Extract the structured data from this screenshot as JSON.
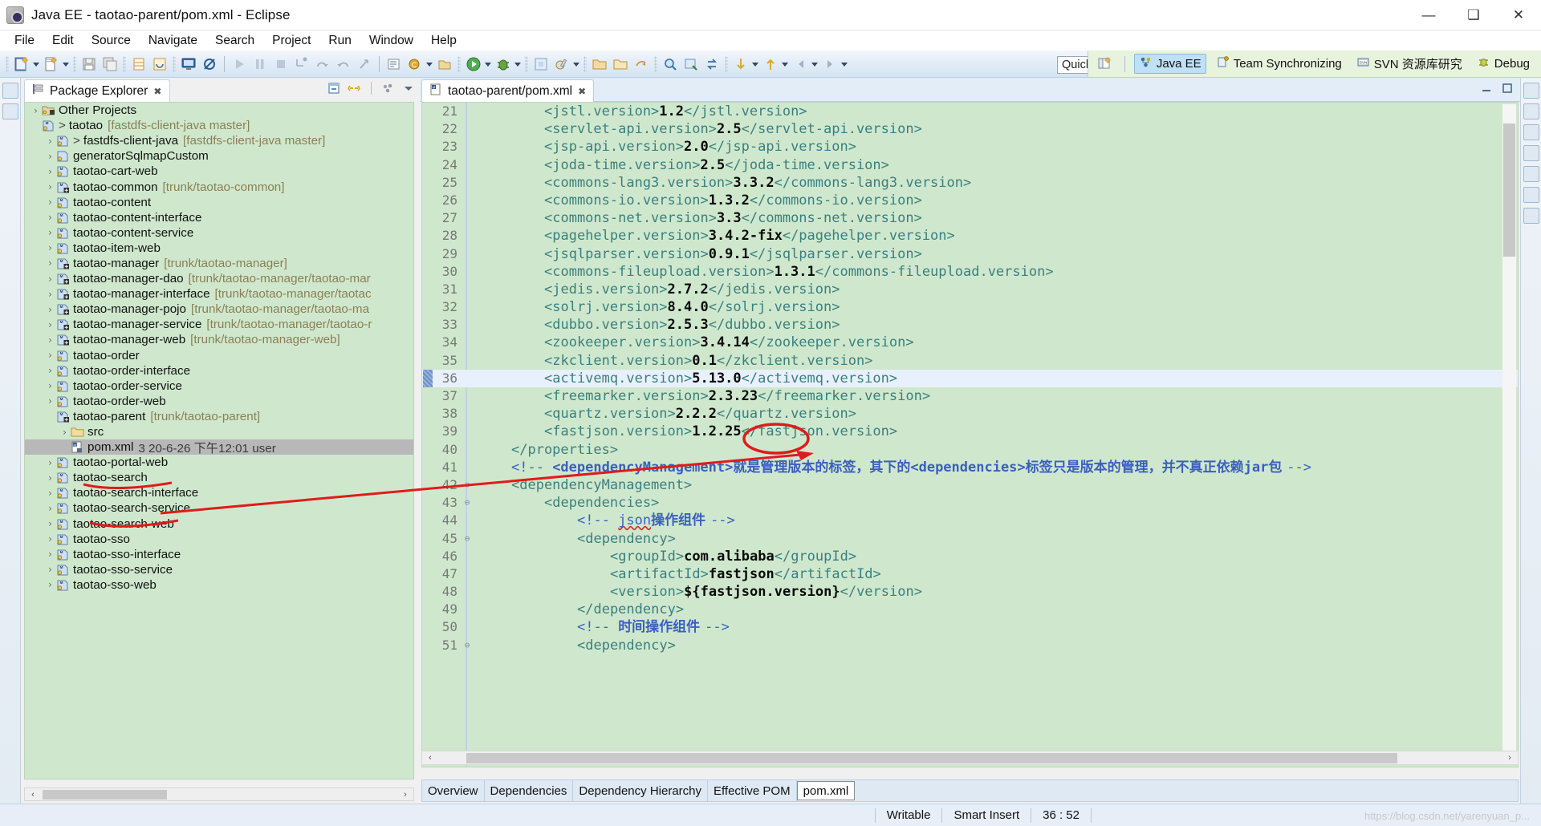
{
  "window": {
    "title": "Java EE - taotao-parent/pom.xml - Eclipse",
    "app_icon": "eclipse-icon",
    "minimize": "—",
    "maximize": "❑",
    "close": "✕"
  },
  "menu": {
    "items": [
      "File",
      "Edit",
      "Source",
      "Navigate",
      "Search",
      "Project",
      "Run",
      "Window",
      "Help"
    ]
  },
  "toolbar": {
    "quick_access_placeholder": "Quick Access",
    "quick_access_value": "Quick Access"
  },
  "perspectives": {
    "items": [
      {
        "label": "Java EE",
        "icon": "java-ee-perspective-icon",
        "active": true
      },
      {
        "label": "Team Synchronizing",
        "icon": "team-sync-icon",
        "active": false
      },
      {
        "label": "SVN 资源库研究",
        "icon": "svn-icon",
        "active": false
      },
      {
        "label": "Debug",
        "icon": "debug-icon",
        "active": false
      }
    ],
    "open_perspective_icon": "open-perspective-icon"
  },
  "package_explorer": {
    "tab_label": "Package Explorer",
    "tab_icon": "package-explorer-icon",
    "close_icon": "✖",
    "tools": [
      "collapse-all-icon",
      "link-with-editor-icon",
      "view-menu-icon",
      "minimize-icon"
    ],
    "tree": [
      {
        "indent": 0,
        "arrow": "›",
        "icon": "other-projects-icon",
        "label": "Other Projects",
        "location": "",
        "prefix": ""
      },
      {
        "indent": 0,
        "arrow": "ⱟ",
        "icon": "maven-project-icon",
        "label": "taotao",
        "location": "[fastdfs-client-java master]",
        "prefix": ">"
      },
      {
        "indent": 1,
        "arrow": "›",
        "icon": "maven-project-icon",
        "label": "fastdfs-client-java",
        "location": "[fastdfs-client-java master]",
        "prefix": ">"
      },
      {
        "indent": 1,
        "arrow": "›",
        "icon": "java-project-icon",
        "label": "generatorSqlmapCustom",
        "location": "",
        "prefix": ""
      },
      {
        "indent": 1,
        "arrow": "›",
        "icon": "maven-project-icon",
        "label": "taotao-cart-web",
        "location": "",
        "prefix": ""
      },
      {
        "indent": 1,
        "arrow": "›",
        "icon": "maven-svn-project-icon",
        "label": "taotao-common",
        "location": "[trunk/taotao-common]",
        "prefix": ""
      },
      {
        "indent": 1,
        "arrow": "›",
        "icon": "maven-project-icon",
        "label": "taotao-content",
        "location": "",
        "prefix": ""
      },
      {
        "indent": 1,
        "arrow": "›",
        "icon": "maven-project-icon",
        "label": "taotao-content-interface",
        "location": "",
        "prefix": ""
      },
      {
        "indent": 1,
        "arrow": "›",
        "icon": "maven-project-icon",
        "label": "taotao-content-service",
        "location": "",
        "prefix": ""
      },
      {
        "indent": 1,
        "arrow": "›",
        "icon": "maven-project-icon",
        "label": "taotao-item-web",
        "location": "",
        "prefix": ""
      },
      {
        "indent": 1,
        "arrow": "›",
        "icon": "maven-svn-project-icon",
        "label": "taotao-manager",
        "location": "[trunk/taotao-manager]",
        "prefix": ""
      },
      {
        "indent": 1,
        "arrow": "›",
        "icon": "maven-svn-project-icon",
        "label": "taotao-manager-dao",
        "location": "[trunk/taotao-manager/taotao-mar",
        "prefix": ""
      },
      {
        "indent": 1,
        "arrow": "›",
        "icon": "maven-svn-project-icon",
        "label": "taotao-manager-interface",
        "location": "[trunk/taotao-manager/taotac",
        "prefix": ""
      },
      {
        "indent": 1,
        "arrow": "›",
        "icon": "maven-svn-project-icon",
        "label": "taotao-manager-pojo",
        "location": "[trunk/taotao-manager/taotao-ma",
        "prefix": ""
      },
      {
        "indent": 1,
        "arrow": "›",
        "icon": "maven-svn-project-icon",
        "label": "taotao-manager-service",
        "location": "[trunk/taotao-manager/taotao-r",
        "prefix": ""
      },
      {
        "indent": 1,
        "arrow": "›",
        "icon": "maven-svn-project-icon",
        "label": "taotao-manager-web",
        "location": "[trunk/taotao-manager-web]",
        "prefix": ""
      },
      {
        "indent": 1,
        "arrow": "›",
        "icon": "maven-project-icon",
        "label": "taotao-order",
        "location": "",
        "prefix": ""
      },
      {
        "indent": 1,
        "arrow": "›",
        "icon": "maven-project-icon",
        "label": "taotao-order-interface",
        "location": "",
        "prefix": ""
      },
      {
        "indent": 1,
        "arrow": "›",
        "icon": "maven-project-icon",
        "label": "taotao-order-service",
        "location": "",
        "prefix": ""
      },
      {
        "indent": 1,
        "arrow": "›",
        "icon": "maven-project-icon",
        "label": "taotao-order-web",
        "location": "",
        "prefix": ""
      },
      {
        "indent": 1,
        "arrow": "ⱟ",
        "icon": "maven-svn-project-icon",
        "label": "taotao-parent",
        "location": "[trunk/taotao-parent]",
        "prefix": "",
        "underlined": true
      },
      {
        "indent": 2,
        "arrow": "›",
        "icon": "folder-icon",
        "label": "src",
        "location": "",
        "prefix": ""
      },
      {
        "indent": 2,
        "arrow": "",
        "icon": "xml-file-icon",
        "label": "pom.xml",
        "location": "3  20-6-26 下午12:01  user",
        "prefix": "",
        "selected": true,
        "underlined": true
      },
      {
        "indent": 1,
        "arrow": "›",
        "icon": "maven-project-icon",
        "label": "taotao-portal-web",
        "location": "",
        "prefix": ""
      },
      {
        "indent": 1,
        "arrow": "›",
        "icon": "maven-project-icon",
        "label": "taotao-search",
        "location": "",
        "prefix": ""
      },
      {
        "indent": 1,
        "arrow": "›",
        "icon": "maven-project-icon",
        "label": "taotao-search-interface",
        "location": "",
        "prefix": ""
      },
      {
        "indent": 1,
        "arrow": "›",
        "icon": "maven-project-icon",
        "label": "taotao-search-service",
        "location": "",
        "prefix": ""
      },
      {
        "indent": 1,
        "arrow": "›",
        "icon": "maven-project-icon",
        "label": "taotao-search-web",
        "location": "",
        "prefix": ""
      },
      {
        "indent": 1,
        "arrow": "›",
        "icon": "maven-project-icon",
        "label": "taotao-sso",
        "location": "",
        "prefix": ""
      },
      {
        "indent": 1,
        "arrow": "›",
        "icon": "maven-project-icon",
        "label": "taotao-sso-interface",
        "location": "",
        "prefix": ""
      },
      {
        "indent": 1,
        "arrow": "›",
        "icon": "maven-project-icon",
        "label": "taotao-sso-service",
        "location": "",
        "prefix": ""
      },
      {
        "indent": 1,
        "arrow": "›",
        "icon": "maven-project-icon",
        "label": "taotao-sso-web",
        "location": "",
        "prefix": ""
      }
    ]
  },
  "editor": {
    "tab_label": "taotao-parent/pom.xml",
    "tab_icon": "maven-pom-icon",
    "tab_close": "✖",
    "current_line": 36,
    "lines": [
      {
        "n": 21,
        "indent": 8,
        "fold": "",
        "parts": [
          {
            "t": "tag",
            "s": "<jstl.version>"
          },
          {
            "t": "val",
            "s": "1.2"
          },
          {
            "t": "tag",
            "s": "</jstl.version>"
          }
        ]
      },
      {
        "n": 22,
        "indent": 8,
        "fold": "",
        "parts": [
          {
            "t": "tag",
            "s": "<servlet-api.version>"
          },
          {
            "t": "val",
            "s": "2.5"
          },
          {
            "t": "tag",
            "s": "</servlet-api.version>"
          }
        ]
      },
      {
        "n": 23,
        "indent": 8,
        "fold": "",
        "parts": [
          {
            "t": "tag",
            "s": "<jsp-api.version>"
          },
          {
            "t": "val",
            "s": "2.0"
          },
          {
            "t": "tag",
            "s": "</jsp-api.version>"
          }
        ]
      },
      {
        "n": 24,
        "indent": 8,
        "fold": "",
        "parts": [
          {
            "t": "tag",
            "s": "<joda-time.version>"
          },
          {
            "t": "val",
            "s": "2.5"
          },
          {
            "t": "tag",
            "s": "</joda-time.version>"
          }
        ]
      },
      {
        "n": 25,
        "indent": 8,
        "fold": "",
        "parts": [
          {
            "t": "tag",
            "s": "<commons-lang3.version>"
          },
          {
            "t": "val",
            "s": "3.3.2"
          },
          {
            "t": "tag",
            "s": "</commons-lang3.version>"
          }
        ]
      },
      {
        "n": 26,
        "indent": 8,
        "fold": "",
        "parts": [
          {
            "t": "tag",
            "s": "<commons-io.version>"
          },
          {
            "t": "val",
            "s": "1.3.2"
          },
          {
            "t": "tag",
            "s": "</commons-io.version>"
          }
        ]
      },
      {
        "n": 27,
        "indent": 8,
        "fold": "",
        "parts": [
          {
            "t": "tag",
            "s": "<commons-net.version>"
          },
          {
            "t": "val",
            "s": "3.3"
          },
          {
            "t": "tag",
            "s": "</commons-net.version>"
          }
        ]
      },
      {
        "n": 28,
        "indent": 8,
        "fold": "",
        "parts": [
          {
            "t": "tag",
            "s": "<pagehelper.version>"
          },
          {
            "t": "val",
            "s": "3.4.2-fix"
          },
          {
            "t": "tag",
            "s": "</pagehelper.version>"
          }
        ]
      },
      {
        "n": 29,
        "indent": 8,
        "fold": "",
        "parts": [
          {
            "t": "tag",
            "s": "<jsqlparser.version>"
          },
          {
            "t": "val",
            "s": "0.9.1"
          },
          {
            "t": "tag",
            "s": "</jsqlparser.version>"
          }
        ]
      },
      {
        "n": 30,
        "indent": 8,
        "fold": "",
        "parts": [
          {
            "t": "tag",
            "s": "<commons-fileupload.version>"
          },
          {
            "t": "val",
            "s": "1.3.1"
          },
          {
            "t": "tag",
            "s": "</commons-fileupload.version>"
          }
        ]
      },
      {
        "n": 31,
        "indent": 8,
        "fold": "",
        "parts": [
          {
            "t": "tag",
            "s": "<jedis.version>"
          },
          {
            "t": "val",
            "s": "2.7.2"
          },
          {
            "t": "tag",
            "s": "</jedis.version>"
          }
        ]
      },
      {
        "n": 32,
        "indent": 8,
        "fold": "",
        "parts": [
          {
            "t": "tag",
            "s": "<solrj.version>"
          },
          {
            "t": "val",
            "s": "8.4.0"
          },
          {
            "t": "tag",
            "s": "</solrj.version>"
          }
        ]
      },
      {
        "n": 33,
        "indent": 8,
        "fold": "",
        "parts": [
          {
            "t": "tag",
            "s": "<dubbo.version>"
          },
          {
            "t": "val",
            "s": "2.5.3"
          },
          {
            "t": "tag",
            "s": "</dubbo.version>"
          }
        ]
      },
      {
        "n": 34,
        "indent": 8,
        "fold": "",
        "parts": [
          {
            "t": "tag",
            "s": "<zookeeper.version>"
          },
          {
            "t": "val",
            "s": "3.4.14"
          },
          {
            "t": "tag",
            "s": "</zookeeper.version>"
          }
        ]
      },
      {
        "n": 35,
        "indent": 8,
        "fold": "",
        "parts": [
          {
            "t": "tag",
            "s": "<zkclient.version>"
          },
          {
            "t": "val",
            "s": "0.1"
          },
          {
            "t": "tag",
            "s": "</zkclient.version>"
          }
        ]
      },
      {
        "n": 36,
        "indent": 8,
        "fold": "",
        "current": true,
        "parts": [
          {
            "t": "tag",
            "s": "<activemq.version>"
          },
          {
            "t": "val",
            "s": "5.13.0"
          },
          {
            "t": "tag",
            "s": "</activemq.version>"
          }
        ]
      },
      {
        "n": 37,
        "indent": 8,
        "fold": "",
        "parts": [
          {
            "t": "tag",
            "s": "<freemarker.version>"
          },
          {
            "t": "val",
            "s": "2.3.23"
          },
          {
            "t": "tag",
            "s": "</freemarker.version>"
          }
        ]
      },
      {
        "n": 38,
        "indent": 8,
        "fold": "",
        "parts": [
          {
            "t": "tag",
            "s": "<quartz.version>"
          },
          {
            "t": "val",
            "s": "2.2.2"
          },
          {
            "t": "tag",
            "s": "</quartz.version>"
          }
        ]
      },
      {
        "n": 39,
        "indent": 8,
        "fold": "",
        "parts": [
          {
            "t": "tag",
            "s": "<fastjson.version>"
          },
          {
            "t": "val",
            "s": "1.2.25"
          },
          {
            "t": "tag",
            "s": "</fastjson.version>"
          }
        ]
      },
      {
        "n": 40,
        "indent": 4,
        "fold": "",
        "parts": [
          {
            "t": "tag",
            "s": "</properties>"
          }
        ]
      },
      {
        "n": 41,
        "indent": 4,
        "fold": "",
        "parts": [
          {
            "t": "cmt",
            "s": "<!-- "
          },
          {
            "t": "cmtb",
            "s": "<dependencyManagement>"
          },
          {
            "t": "cmtcn",
            "s": "就是管理版本的标签，其下的"
          },
          {
            "t": "cmtb",
            "s": "<dependencies>"
          },
          {
            "t": "cmtcn",
            "s": "标签只是版本的管理，并不真正依赖"
          },
          {
            "t": "cmtb",
            "s": "jar"
          },
          {
            "t": "cmtcn",
            "s": "包 "
          },
          {
            "t": "cmt",
            "s": "-->"
          }
        ]
      },
      {
        "n": 42,
        "indent": 4,
        "fold": "⊖",
        "parts": [
          {
            "t": "tag",
            "s": "<dependencyManagement>"
          }
        ]
      },
      {
        "n": 43,
        "indent": 8,
        "fold": "⊖",
        "parts": [
          {
            "t": "tag",
            "s": "<dependencies>"
          }
        ]
      },
      {
        "n": 44,
        "indent": 12,
        "fold": "",
        "parts": [
          {
            "t": "cmt",
            "s": "<!-- "
          },
          {
            "t": "spell",
            "s": "json"
          },
          {
            "t": "cmtcn",
            "s": "操作组件 "
          },
          {
            "t": "cmt",
            "s": "-->"
          }
        ]
      },
      {
        "n": 45,
        "indent": 12,
        "fold": "⊖",
        "parts": [
          {
            "t": "tag",
            "s": "<dependency>"
          }
        ]
      },
      {
        "n": 46,
        "indent": 16,
        "fold": "",
        "parts": [
          {
            "t": "tag",
            "s": "<groupId>"
          },
          {
            "t": "val",
            "s": "com.alibaba"
          },
          {
            "t": "tag",
            "s": "</groupId>"
          }
        ]
      },
      {
        "n": 47,
        "indent": 16,
        "fold": "",
        "parts": [
          {
            "t": "tag",
            "s": "<artifactId>"
          },
          {
            "t": "val",
            "s": "fastjson"
          },
          {
            "t": "tag",
            "s": "</artifactId>"
          }
        ]
      },
      {
        "n": 48,
        "indent": 16,
        "fold": "",
        "parts": [
          {
            "t": "tag",
            "s": "<version>"
          },
          {
            "t": "val",
            "s": "${fastjson.version}"
          },
          {
            "t": "tag",
            "s": "</version>"
          }
        ]
      },
      {
        "n": 49,
        "indent": 12,
        "fold": "",
        "parts": [
          {
            "t": "tag",
            "s": "</dependency>"
          }
        ]
      },
      {
        "n": 50,
        "indent": 12,
        "fold": "",
        "parts": [
          {
            "t": "cmt",
            "s": "<!-- "
          },
          {
            "t": "cmtcn",
            "s": "时间操作组件 "
          },
          {
            "t": "cmt",
            "s": "-->"
          }
        ]
      },
      {
        "n": 51,
        "indent": 12,
        "fold": "⊖",
        "parts": [
          {
            "t": "tag",
            "s": "<dependency>"
          }
        ]
      }
    ],
    "bottom_tabs": [
      {
        "label": "Overview",
        "active": false
      },
      {
        "label": "Dependencies",
        "active": false
      },
      {
        "label": "Dependency Hierarchy",
        "active": false
      },
      {
        "label": "Effective POM",
        "active": false
      },
      {
        "label": "pom.xml",
        "active": true
      }
    ]
  },
  "status_bar": {
    "writable": "Writable",
    "insert_mode": "Smart Insert",
    "position": "36 : 52",
    "watermark": "https://blog.csdn.net/yarenyuan_p..."
  },
  "annotations": {
    "circle_target": "5.13.0",
    "underline_taotao_parent": true,
    "underline_pom_xml": true,
    "arrow": "pom-xml-to-activemq-version"
  },
  "colors": {
    "tree_bg": "#cfe8cd",
    "editor_bg": "#cfe8cd",
    "tag": "#3a7f7f",
    "comment": "#3b5fc0",
    "annotation_red": "#e01b1b",
    "selection_gray": "#b8b8b8",
    "current_line": "#e8f0fb",
    "perspective_bar": "#e8f3dd"
  }
}
